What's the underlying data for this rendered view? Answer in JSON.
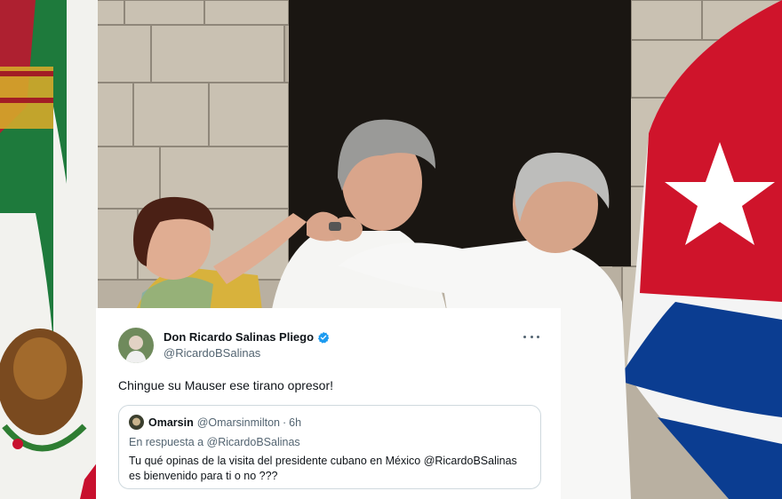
{
  "tweet": {
    "display_name": "Don Ricardo Salinas Pliego",
    "handle": "@RicardoBSalinas",
    "text": "Chingue su Mauser ese tirano opresor!",
    "verified_color": "#1d9bf0"
  },
  "quote": {
    "display_name": "Omarsin",
    "handle": "@Omarsinmilton",
    "separator": "·",
    "time": "6h",
    "reply_to": "En respuesta a @RicardoBSalinas",
    "text_line1": "Tu qué opinas de la visita del presidente cubano en México @RicardoBSalinas",
    "text_line2": "es bienvenido para ti o no ???"
  },
  "colors": {
    "mexico_green": "#1e7a3c",
    "mexico_red": "#c8102e",
    "cuba_blue": "#0b3d91",
    "cuba_red": "#cf142b"
  }
}
